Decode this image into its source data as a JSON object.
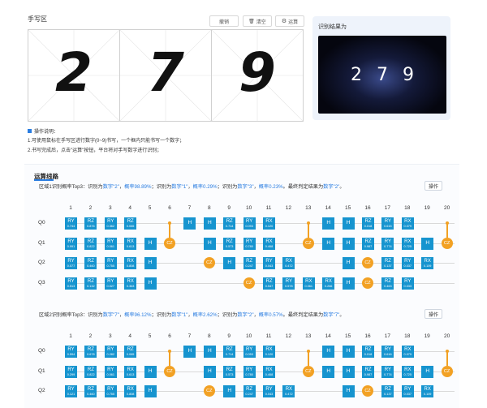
{
  "handwriting": {
    "title": "手写区",
    "undo_label": "撤销",
    "clear_label": "清空",
    "compute_label": "运算",
    "digits": [
      "2",
      "7",
      "9"
    ]
  },
  "result": {
    "label": "识别结果为",
    "digits": [
      "2",
      "7",
      "9"
    ]
  },
  "instructions": {
    "title": "操作说明：",
    "line1": "1.可使用鼠标在手写区进行数字(0~9)书写，一个框内只能书写一个数字；",
    "line2": "2.书写完成后，点击\"运算\"按钮，平台将对手写数字进行识别；"
  },
  "circuit": {
    "title": "运算线路",
    "operate_label": "操作",
    "columns": [
      "1",
      "2",
      "3",
      "4",
      "5",
      "6",
      "7",
      "8",
      "9",
      "10",
      "11",
      "12",
      "13",
      "14",
      "15",
      "16",
      "17",
      "18",
      "19",
      "20"
    ],
    "qubits": [
      "Q0",
      "Q1",
      "Q2",
      "Q3"
    ],
    "regions": [
      {
        "label": "区域1识别概率Top3：识别为",
        "items": [
          {
            "digit": "数字\"2\"",
            "sep1": "，",
            "prob_label": "概率98.89%",
            "sep2": "；识别为"
          },
          {
            "digit": "数字\"1\"",
            "sep1": "，",
            "prob_label": "概率0.29%",
            "sep2": "；识别为"
          },
          {
            "digit": "数字\"3\"",
            "sep1": "，",
            "prob_label": "概率0.23%",
            "sep2": "。最终判定结果为"
          }
        ],
        "final": "数字\"2\"",
        "end": "。"
      },
      {
        "label": "区域2识别概率Top3：识别为",
        "items": [
          {
            "digit": "数字\"7\"",
            "sep1": "，",
            "prob_label": "概率96.12%",
            "sep2": "；识别为"
          },
          {
            "digit": "数字\"1\"",
            "sep1": "，",
            "prob_label": "概率2.62%",
            "sep2": "；识别为"
          },
          {
            "digit": "数字\"2\"",
            "sep1": "，",
            "prob_label": "概率0.57%",
            "sep2": "。最终判定结果为"
          }
        ],
        "final": "数字\"7\"",
        "end": "。"
      }
    ],
    "gate_rows": [
      [
        [
          {
            "t": "RY",
            "v": "0.744"
          },
          {
            "t": "RZ",
            "v": "0.876"
          },
          {
            "t": "RY",
            "v": "0.362"
          },
          {
            "t": "RZ",
            "v": "0.065"
          },
          {
            "t": "ctl"
          },
          {
            "t": "H"
          },
          {
            "t": "H"
          },
          {
            "t": "RZ",
            "v": "0.714"
          },
          {
            "t": "RY",
            "v": "0.093"
          },
          {
            "t": "RX",
            "v": "0.120"
          },
          {
            "t": "ctl"
          },
          {
            "t": "H"
          },
          {
            "t": "H"
          },
          {
            "t": "RZ",
            "v": "0.018"
          },
          {
            "t": "RY",
            "v": "0.615"
          },
          {
            "t": "RX",
            "v": "0.079"
          },
          {
            "t": "ctl"
          }
        ],
        [
          {
            "t": "RY",
            "v": "0.991"
          },
          {
            "t": "RZ",
            "v": "0.822"
          },
          {
            "t": "RY",
            "v": "0.061"
          },
          {
            "t": "RX",
            "v": "0.613"
          },
          {
            "t": "H"
          },
          {
            "t": "CZ"
          },
          {
            "t": "H"
          },
          {
            "t": "RZ",
            "v": "0.573"
          },
          {
            "t": "RY",
            "v": "0.780"
          },
          {
            "t": "RX",
            "v": "0.468"
          },
          {
            "t": "CZ"
          },
          {
            "t": "H"
          },
          {
            "t": "H"
          },
          {
            "t": "RZ",
            "v": "0.987"
          },
          {
            "t": "RY",
            "v": "0.774"
          },
          {
            "t": "RX",
            "v": "0.725"
          },
          {
            "t": "H"
          },
          {
            "t": "CZ"
          }
        ],
        [
          {
            "t": "RY",
            "v": "0.077"
          },
          {
            "t": "RZ",
            "v": "0.460"
          },
          {
            "t": "RY",
            "v": "0.755"
          },
          {
            "t": "RX",
            "v": "0.808"
          },
          {
            "t": "H"
          },
          {
            "t": "CZ"
          },
          {
            "t": "H"
          },
          {
            "t": "RZ",
            "v": "0.247"
          },
          {
            "t": "RY",
            "v": "0.043"
          },
          {
            "t": "RX",
            "v": "0.472"
          },
          {
            "t": "H"
          },
          {
            "t": "CZ"
          },
          {
            "t": "RZ",
            "v": "0.137"
          },
          {
            "t": "RY",
            "v": "0.037"
          },
          {
            "t": "RX",
            "v": "0.109"
          }
        ],
        [
          {
            "t": "RY",
            "v": "0.513"
          },
          {
            "t": "RZ",
            "v": "0.132"
          },
          {
            "t": "RY",
            "v": "0.027"
          },
          {
            "t": "RX",
            "v": "0.363"
          },
          {
            "t": "H"
          },
          {
            "t": "CZ"
          },
          {
            "t": "RZ",
            "v": "0.547"
          },
          {
            "t": "RY",
            "v": "0.578"
          },
          {
            "t": "RX",
            "v": "0.061"
          },
          {
            "t": "RX",
            "v": "0.266"
          },
          {
            "t": "H"
          },
          {
            "t": "CZ"
          },
          {
            "t": "RZ",
            "v": "0.463"
          },
          {
            "t": "RY",
            "v": "0.033"
          }
        ]
      ],
      [
        [
          {
            "t": "RY",
            "v": "0.594"
          },
          {
            "t": "RZ",
            "v": "0.678"
          },
          {
            "t": "RY",
            "v": "0.282"
          },
          {
            "t": "RZ",
            "v": "0.065"
          },
          {
            "t": "ctl"
          },
          {
            "t": "H"
          },
          {
            "t": "H"
          },
          {
            "t": "RZ",
            "v": "0.714"
          },
          {
            "t": "RY",
            "v": "0.053"
          },
          {
            "t": "RX",
            "v": "0.120"
          },
          {
            "t": "ctl"
          },
          {
            "t": "H"
          },
          {
            "t": "H"
          },
          {
            "t": "RZ",
            "v": "0.018"
          },
          {
            "t": "RY",
            "v": "0.616"
          },
          {
            "t": "RX",
            "v": "0.079"
          },
          {
            "t": "ctl"
          }
        ],
        [
          {
            "t": "RY",
            "v": "0.299"
          },
          {
            "t": "RZ",
            "v": "0.822"
          },
          {
            "t": "RY",
            "v": "0.061"
          },
          {
            "t": "RX",
            "v": "0.613"
          },
          {
            "t": "H"
          },
          {
            "t": "CZ"
          },
          {
            "t": "H"
          },
          {
            "t": "RZ",
            "v": "0.573"
          },
          {
            "t": "RY",
            "v": "0.780"
          },
          {
            "t": "RX",
            "v": "0.468"
          },
          {
            "t": "CZ"
          },
          {
            "t": "H"
          },
          {
            "t": "H"
          },
          {
            "t": "RZ",
            "v": "0.987"
          },
          {
            "t": "RY",
            "v": "0.774"
          },
          {
            "t": "RX",
            "v": "0.725"
          },
          {
            "t": "H"
          },
          {
            "t": "CZ"
          }
        ],
        [
          {
            "t": "RY",
            "v": "0.121"
          },
          {
            "t": "RZ",
            "v": "0.460"
          },
          {
            "t": "RY",
            "v": "0.755"
          },
          {
            "t": "RX",
            "v": "0.808"
          },
          {
            "t": "H"
          },
          {
            "t": "CZ"
          },
          {
            "t": "H"
          },
          {
            "t": "RZ",
            "v": "0.247"
          },
          {
            "t": "RY",
            "v": "0.043"
          },
          {
            "t": "RX",
            "v": "0.472"
          },
          {
            "t": "H"
          },
          {
            "t": "CZ"
          },
          {
            "t": "RZ",
            "v": "0.137"
          },
          {
            "t": "RY",
            "v": "0.037"
          },
          {
            "t": "RX",
            "v": "0.109"
          }
        ]
      ]
    ]
  }
}
